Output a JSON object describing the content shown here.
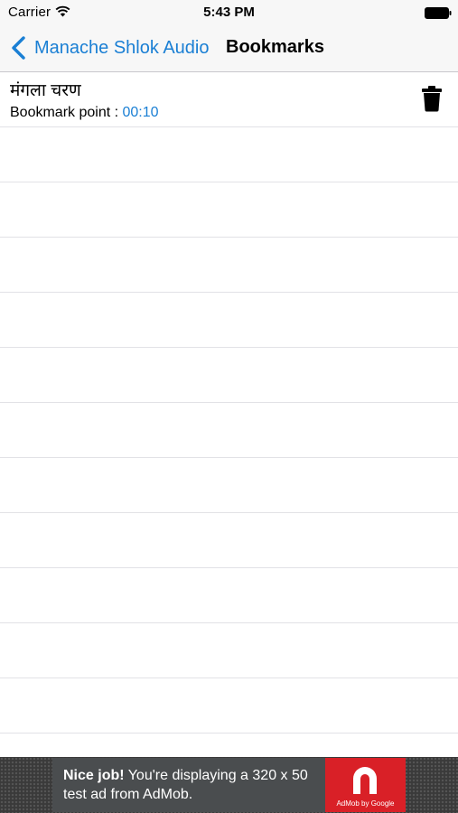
{
  "status_bar": {
    "carrier": "Carrier",
    "time": "5:43 PM",
    "icons": [
      "wifi-icon",
      "battery-icon"
    ]
  },
  "nav": {
    "back_label": "Manache Shlok Audio",
    "title": "Bookmarks",
    "accent_color": "#1a7fd4"
  },
  "bookmarks": [
    {
      "title": "मंगला चरण",
      "point_label": "Bookmark point : ",
      "point_time": "00:10",
      "delete_icon": "trash-icon"
    }
  ],
  "ad": {
    "headline": "Nice job!",
    "body": " You're displaying a 320 x 50 test ad from AdMob.",
    "logo_text": "AdMob by Google",
    "logo_color": "#d92027"
  }
}
